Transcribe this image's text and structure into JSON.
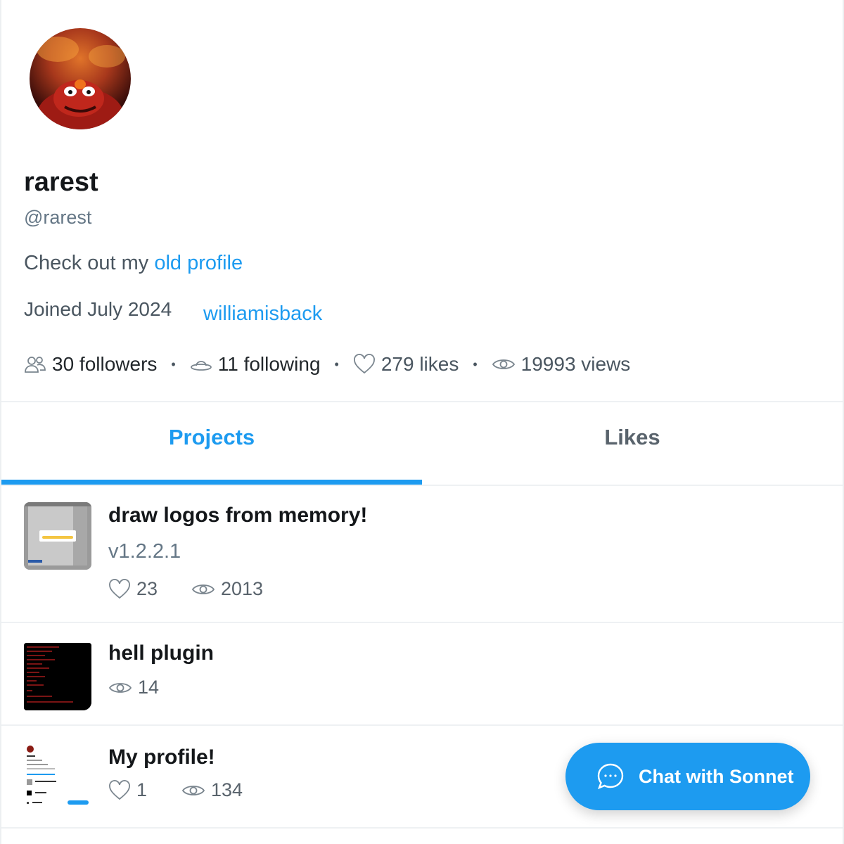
{
  "profile": {
    "display_name": "rarest",
    "handle": "@rarest",
    "bio_prefix": "Check out my ",
    "bio_link": "old profile",
    "joined": "Joined July 2024",
    "website": "williamisback"
  },
  "stats": {
    "followers": "30 followers",
    "following": "11 following",
    "likes": "279 likes",
    "views": "19993 views",
    "separator": "•"
  },
  "tabs": [
    {
      "label": "Projects",
      "active": true
    },
    {
      "label": "Likes",
      "active": false
    }
  ],
  "projects": [
    {
      "title": "draw logos from memory!",
      "version": "v1.2.2.1",
      "likes": "23",
      "views": "2013",
      "thumb_icon": "app-screenshot"
    },
    {
      "title": "hell plugin",
      "views": "14",
      "thumb_icon": "terminal-screenshot"
    },
    {
      "title": "My profile!",
      "likes": "1",
      "views": "134",
      "thumb_icon": "profile-screenshot"
    }
  ],
  "chat": {
    "label": "Chat with Sonnet",
    "icon": "chat-bubble-icon"
  },
  "colors": {
    "accent": "#1d9bf0",
    "text": "#14171a",
    "muted": "#657786",
    "divider": "#eef1f3"
  }
}
